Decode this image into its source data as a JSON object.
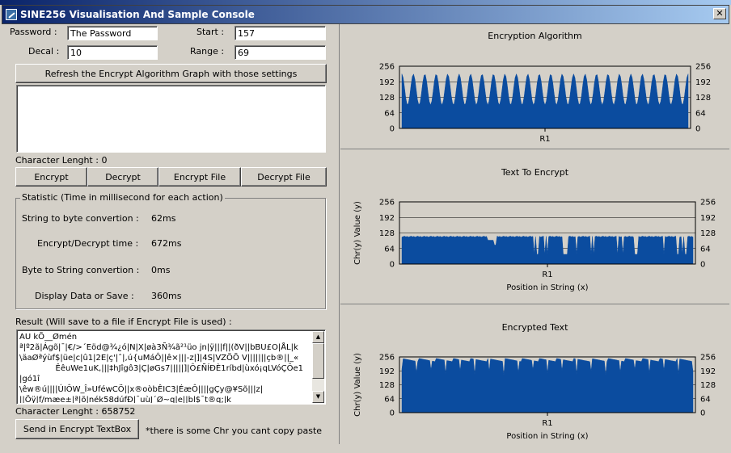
{
  "window": {
    "title": "SINE256 Visualisation And Sample Console",
    "background_title": "SINE256 Visualisation And Sample Console",
    "close_glyph": "✕"
  },
  "form": {
    "password_label": "Password :",
    "password_value": "The Password",
    "start_label": "Start :",
    "start_value": "157",
    "decal_label": "Decal :",
    "decal_value": "10",
    "range_label": "Range :",
    "range_value": "69",
    "refresh_button": "Refresh the Encrypt Algorithm Graph with those settings",
    "input_text": "",
    "char_length": "Character Lenght : 0"
  },
  "actions": {
    "encrypt": "Encrypt",
    "decrypt": "Decrypt",
    "encrypt_file": "Encrypt File",
    "decrypt_file": "Decrypt File"
  },
  "statistic": {
    "legend": "Statistic (Time in millisecond for each action)",
    "rows": [
      {
        "label": "String to byte convertion :",
        "value": "62ms"
      },
      {
        "label": "Encrypt/Decrypt time :",
        "value": "672ms"
      },
      {
        "label": "Byte to String convertion :",
        "value": "0ms"
      },
      {
        "label": "Display Data or Save :",
        "value": "360ms"
      }
    ]
  },
  "result": {
    "label": "Result (Will save to a file if Encrypt File is used) :",
    "lines": [
      "AU kÕ__Ømén",
      "ª|º2ã|Ágõ|¯|€/>´Eöd@¾¿ó|N|X|øà3Ñ¾ã²¹üo jn|ÿ|||f||(ðV||bBU£O|ÅL|k",
      "\\äaØªýùf$|üe|c|û1|2E|ç'|ˆ|,ú{uMáÔ||ê×|||-z|]|4S|VZÖÕ V|||||||çb®||_«",
      "              ÊêuWe1uK,|||‡hJîgô3|Ç|øGs7|||||]|Ô£ÑÍÐÈ1ríbd|ùxó¡qLVóÇÔe1",
      "|gó1î",
      "\\êw®ú||||ÚIÔW_Î»UféwCÖ||x®oòbÊIC3|ÉæÔ||||gÇy@¥Sõ|||z|",
      "||Öÿ|f/mæe±|ª|õ|nék58dúfÐ|¯uùJ´Ø~q|e||bl$¯t®q;|k"
    ],
    "char_length": "Character Lenght : 658752",
    "send_button": "Send in Encrypt TextBox",
    "note": "*there is some Chr you cant copy paste"
  },
  "charts": {
    "encryption": {
      "title": "Encryption Algorithm",
      "xcat": "R1",
      "ylabel": "",
      "xlabel": "",
      "ticks": [
        "0",
        "64",
        "128",
        "192",
        "256"
      ]
    },
    "text": {
      "title": "Text To Encrypt",
      "xcat": "R1",
      "ylabel": "Chr(y) Value (y)",
      "xlabel": "Position in String (x)",
      "ticks": [
        "0",
        "64",
        "128",
        "192",
        "256"
      ]
    },
    "encrypted": {
      "title": "Encrypted Text",
      "xcat": "R1",
      "ylabel": "Chr(y) Value (y)",
      "xlabel": "Position in String (x)",
      "ticks": [
        "0",
        "64",
        "128",
        "192",
        "256"
      ]
    }
  },
  "chart_data": [
    {
      "type": "area",
      "title": "Encryption Algorithm",
      "xlabel": "",
      "ylabel": "",
      "categories": [
        "R1"
      ],
      "ylim": [
        0,
        256
      ],
      "yticks": [
        0,
        64,
        128,
        192,
        256
      ],
      "series": [
        {
          "description_values": {
            "min": 95,
            "max": 226,
            "peaks": 25
          }
        }
      ],
      "color": "#0b4c9f"
    },
    {
      "type": "area",
      "title": "Text To Encrypt",
      "xlabel": "Position in String (x)",
      "ylabel": "Chr(y) Value (y)",
      "categories": [
        "R1"
      ],
      "ylim": [
        0,
        256
      ],
      "yticks": [
        0,
        64,
        128,
        192,
        256
      ],
      "series": [
        {
          "typical_value": 114
        }
      ],
      "color": "#0b4c9f"
    },
    {
      "type": "area",
      "title": "Encrypted Text",
      "xlabel": "Position in String (x)",
      "ylabel": "Chr(y) Value (y)",
      "categories": [
        "R1"
      ],
      "ylim": [
        0,
        256
      ],
      "yticks": [
        0,
        64,
        128,
        192,
        256
      ],
      "series": [
        {
          "typical_value": 250
        }
      ],
      "color": "#0b4c9f"
    }
  ]
}
